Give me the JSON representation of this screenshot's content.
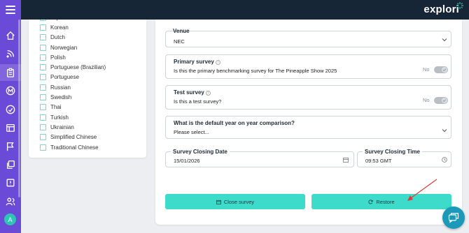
{
  "brand": {
    "logo": "explori",
    "accent": "#3ddbc9",
    "rail_color": "#6a4bd8",
    "topbar_color": "#162636"
  },
  "nav": {
    "icons": [
      "home-icon",
      "rss-icon",
      "clipboard-icon",
      "m-badge-icon",
      "gauge-icon",
      "calendar-icon",
      "flag-icon",
      "copy-icon",
      "report-icon",
      "users-icon"
    ],
    "avatar_initial": "A"
  },
  "languages": {
    "items": [
      "Japanese",
      "Korean",
      "Dutch",
      "Norwegian",
      "Polish",
      "Portuguese (Brazilian)",
      "Portuguese",
      "Russian",
      "Swedish",
      "Thai",
      "Turkish",
      "Ukrainian",
      "Simplified Chinese",
      "Traditional Chinese"
    ]
  },
  "form": {
    "venue": {
      "label": "Venue",
      "value": "NEC"
    },
    "primary_survey": {
      "label": "Primary survey",
      "question": "Is this the primary benchmarking survey for The Pineapple Show 2025",
      "state": "No"
    },
    "test_survey": {
      "label": "Test survey",
      "question": "Is this a test survey?",
      "state": "No"
    },
    "default_year": {
      "label": "What is the default year on year comparison?",
      "placeholder": "Please select..."
    },
    "closing_date": {
      "label": "Survey Closing Date",
      "value": "15/01/2026"
    },
    "closing_time": {
      "label": "Survey Closing Time",
      "value": "09:53 GMT"
    },
    "close_button": "Close survey",
    "restore_button": "Restore"
  }
}
